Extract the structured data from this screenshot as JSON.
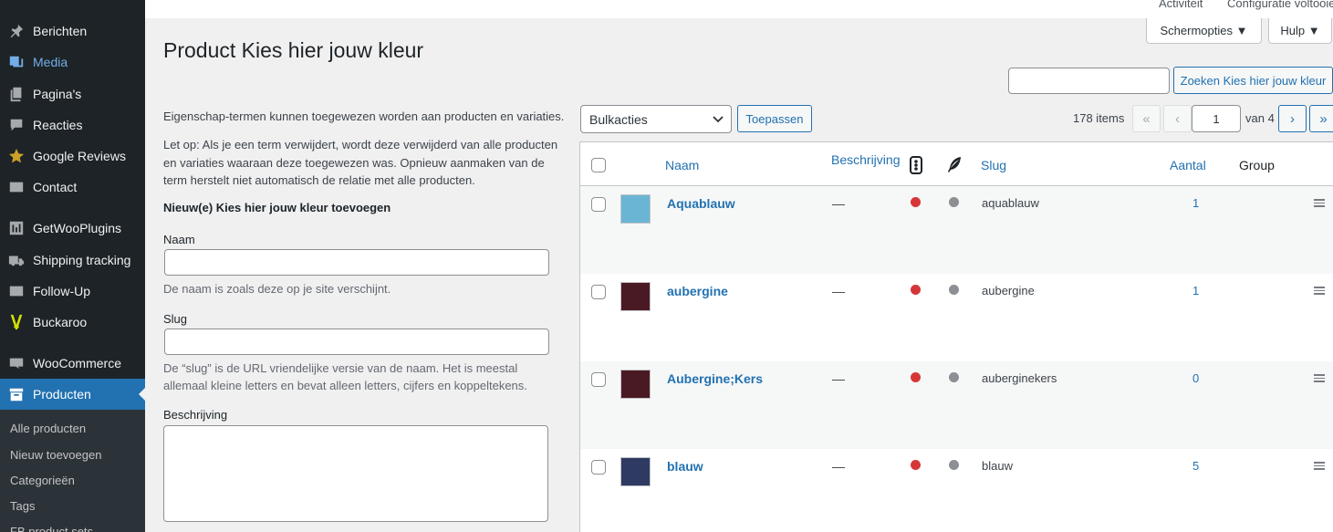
{
  "sidebar": {
    "items": [
      {
        "label": "Berichten",
        "icon": "pin-icon"
      },
      {
        "label": "Media",
        "icon": "media-icon"
      },
      {
        "label": "Pagina's",
        "icon": "pages-icon"
      },
      {
        "label": "Reacties",
        "icon": "comments-icon"
      },
      {
        "label": "Google Reviews",
        "icon": "star-icon"
      },
      {
        "label": "Contact",
        "icon": "mail-icon"
      },
      {
        "label": "GetWooPlugins",
        "icon": "plugins-icon"
      },
      {
        "label": "Shipping tracking",
        "icon": "truck-icon"
      },
      {
        "label": "Follow-Up",
        "icon": "mail-icon"
      },
      {
        "label": "Buckaroo",
        "icon": "buckaroo-icon"
      },
      {
        "label": "WooCommerce",
        "icon": "woo-icon"
      },
      {
        "label": "Producten",
        "icon": "archive-icon"
      }
    ],
    "submenu": [
      "Alle producten",
      "Nieuw toevoegen",
      "Categorieën",
      "Tags",
      "FB product sets"
    ]
  },
  "topbar": {
    "links": [
      "Activiteit",
      "Configuratie voltooien"
    ],
    "screen_options": "Schermopties ▼",
    "help": "Hulp ▼"
  },
  "page": {
    "title": "Product Kies hier jouw kleur",
    "search_button": "Zoeken Kies hier jouw kleur",
    "search_value": ""
  },
  "form": {
    "intro": "Eigenschap-termen kunnen toegewezen worden aan producten en variaties.",
    "note": "Let op: Als je een term verwijdert, wordt deze verwijderd van alle producten en variaties waaraan deze toegewezen was. Opnieuw aanmaken van de term herstelt niet automatisch de relatie met alle producten.",
    "title": "Nieuw(e) Kies hier jouw kleur toevoegen",
    "name_label": "Naam",
    "name_desc": "De naam is zoals deze op je site verschijnt.",
    "slug_label": "Slug",
    "slug_desc": "De “slug” is de URL vriendelijke versie van de naam. Het is meestal allemaal kleine letters en bevat alleen letters, cijfers en koppeltekens.",
    "desc_label": "Beschrijving"
  },
  "list": {
    "bulk_select": "Bulkacties",
    "apply": "Toepassen",
    "items_count": "178 items",
    "current_page": "1",
    "of_pages": "van 4",
    "pag_first": "«",
    "pag_prev": "‹",
    "pag_next": "›",
    "pag_last": "»",
    "columns": {
      "name": "Naam",
      "description": "Beschrijving",
      "slug": "Slug",
      "count": "Aantal",
      "group": "Group"
    },
    "rows": [
      {
        "name": "Aquablauw",
        "description": "—",
        "slug": "aquablauw",
        "count": "1",
        "color": "#6bb5d4"
      },
      {
        "name": "aubergine",
        "description": "—",
        "slug": "aubergine",
        "count": "1",
        "color": "#4a1a24"
      },
      {
        "name": "Aubergine;Kers",
        "description": "—",
        "slug": "auberginekers",
        "count": "0",
        "color": "#4a1a24"
      },
      {
        "name": "blauw",
        "description": "—",
        "slug": "blauw",
        "count": "5",
        "color": "#2f3a63"
      }
    ],
    "status_colors": {
      "red": "#d63638",
      "grey": "#8c8f94"
    }
  }
}
